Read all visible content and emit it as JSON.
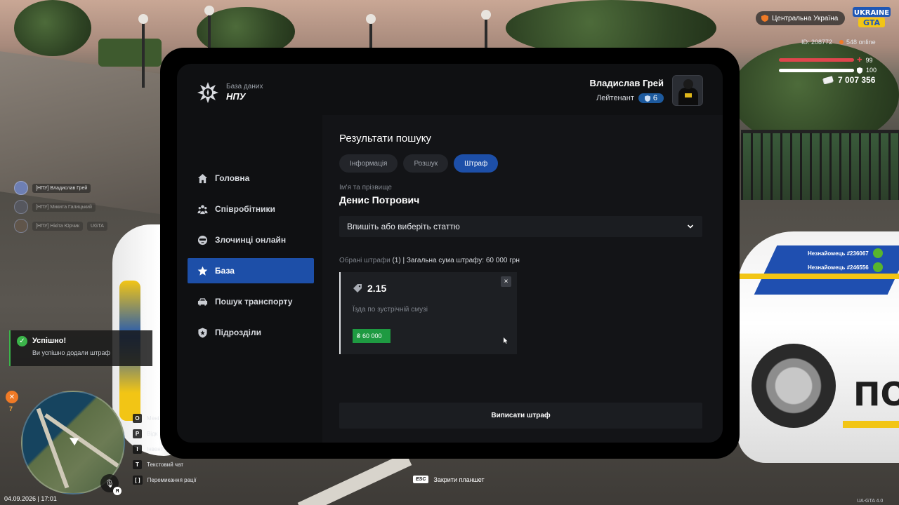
{
  "tablet": {
    "brand_caption": "База даних",
    "brand_name": "НПУ",
    "user": {
      "name": "Владислав Грей",
      "rank": "Лейтенант",
      "level": "6"
    },
    "nav": [
      {
        "label": "Головна",
        "icon": "home-icon",
        "active": false
      },
      {
        "label": "Співробітники",
        "icon": "users-icon",
        "active": false
      },
      {
        "label": "Злочинці онлайн",
        "icon": "criminal-icon",
        "active": false
      },
      {
        "label": "База",
        "icon": "star-icon",
        "active": true
      },
      {
        "label": "Пошук транспорту",
        "icon": "car-icon",
        "active": false
      },
      {
        "label": "Підрозділи",
        "icon": "shield-icon",
        "active": false
      }
    ],
    "main": {
      "title": "Результати пошуку",
      "tabs": [
        {
          "label": "Інформація",
          "active": false
        },
        {
          "label": "Розшук",
          "active": false
        },
        {
          "label": "Штраф",
          "active": true
        }
      ],
      "name_label": "Ім'я та прізвище",
      "person_name": "Денис Потрович",
      "article_select": "Впишіть або виберіть статтю",
      "summary_muted": "Обрані штрафи",
      "summary_text": " (1) | Загальна сума штрафу: 60 000 грн",
      "fine": {
        "code": "2.15",
        "description": "Їзда по зустрічній смузі",
        "amount": "60 000",
        "currency_symbol": "₴",
        "close": "×"
      },
      "issue_button": "Виписати штраф"
    }
  },
  "hud": {
    "region": "Центральна Україна",
    "logo_text": "UKRAINE GTA",
    "player_id": "ID: 208772",
    "online": "548 online",
    "health": "99",
    "armor": "100",
    "money": "7 007 356",
    "chat": [
      {
        "name": "[НПУ] Владислав Грей"
      },
      {
        "name": "[НПУ] Микита Галицький"
      },
      {
        "name": "[НПУ] Нікіта Юрчик"
      }
    ],
    "chat_tag": "UGTA",
    "strangers": [
      "Незнайомець #236067",
      "Незнайомець #246556"
    ],
    "toast": {
      "title": "Успішно!",
      "message": "Ви успішно додали штраф"
    },
    "hunger": "7",
    "keys": [
      {
        "key": "O",
        "label": "Мені"
      },
      {
        "key": "P",
        "label": "Відк"
      },
      {
        "key": "I",
        "label": "Інвент"
      },
      {
        "key": "T",
        "label": "Текстовий чат"
      },
      {
        "key": "[ ]",
        "label": "Перемикання рації"
      }
    ],
    "lang": "Я",
    "datetime": "04.09.2026 | 17:01",
    "esc_key": "ESC",
    "esc_label": "Закрити планшет",
    "version": "UA-GTA 4.0"
  },
  "scene_text": {
    "car_word": "ПО"
  },
  "colors": {
    "accent": "#1d4fa8",
    "success": "#1e9a41",
    "health": "#e0454d",
    "armor": "#ffffff"
  }
}
